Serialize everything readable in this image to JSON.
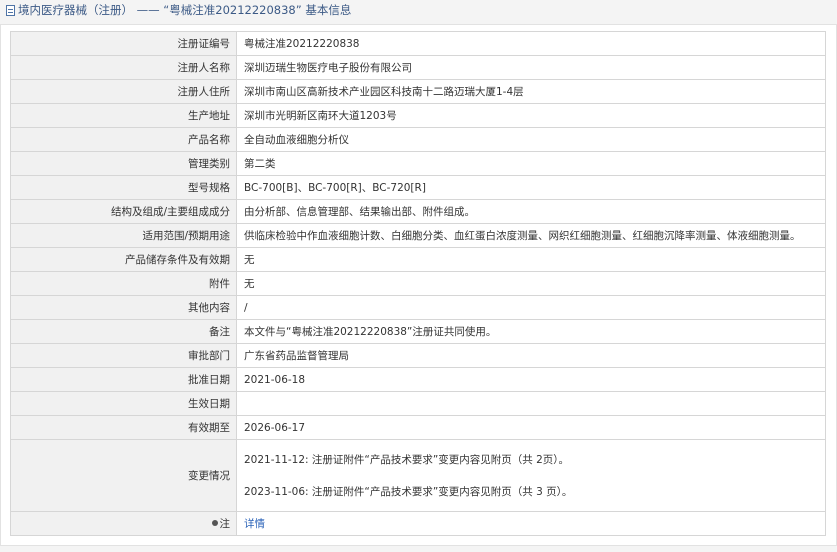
{
  "header": {
    "title": "境内医疗器械（注册） —— “粤械注准20212220838” 基本信息"
  },
  "rows": [
    {
      "label": "注册证编号",
      "value": "粤械注准20212220838"
    },
    {
      "label": "注册人名称",
      "value": "深圳迈瑞生物医疗电子股份有限公司"
    },
    {
      "label": "注册人住所",
      "value": "深圳市南山区高新技术产业园区科技南十二路迈瑞大厦1-4层"
    },
    {
      "label": "生产地址",
      "value": "深圳市光明新区南环大道1203号"
    },
    {
      "label": "产品名称",
      "value": "全自动血液细胞分析仪"
    },
    {
      "label": "管理类别",
      "value": "第二类"
    },
    {
      "label": "型号规格",
      "value": "BC-700[B]、BC-700[R]、BC-720[R]"
    },
    {
      "label": "结构及组成/主要组成成分",
      "value": "由分析部、信息管理部、结果输出部、附件组成。"
    },
    {
      "label": "适用范围/预期用途",
      "value": "供临床检验中作血液细胞计数、白细胞分类、血红蛋白浓度测量、网织红细胞测量、红细胞沉降率测量、体液细胞测量。"
    },
    {
      "label": "产品储存条件及有效期",
      "value": "无"
    },
    {
      "label": "附件",
      "value": "无"
    },
    {
      "label": "其他内容",
      "value": "/"
    },
    {
      "label": "备注",
      "value": "本文件与“粤械注准20212220838”注册证共同使用。"
    },
    {
      "label": "审批部门",
      "value": "广东省药品监督管理局"
    },
    {
      "label": "批准日期",
      "value": "2021-06-18"
    },
    {
      "label": "生效日期",
      "value": ""
    },
    {
      "label": "有效期至",
      "value": "2026-06-17"
    }
  ],
  "changes": {
    "label": "变更情况",
    "items": [
      "2021-11-12: 注册证附件“产品技术要求”变更内容见附页（共 2页）。",
      "2023-11-06: 注册证附件“产品技术要求”变更内容见附页（共 3 页）。"
    ]
  },
  "note": {
    "label": "注",
    "link_text": "详情"
  }
}
